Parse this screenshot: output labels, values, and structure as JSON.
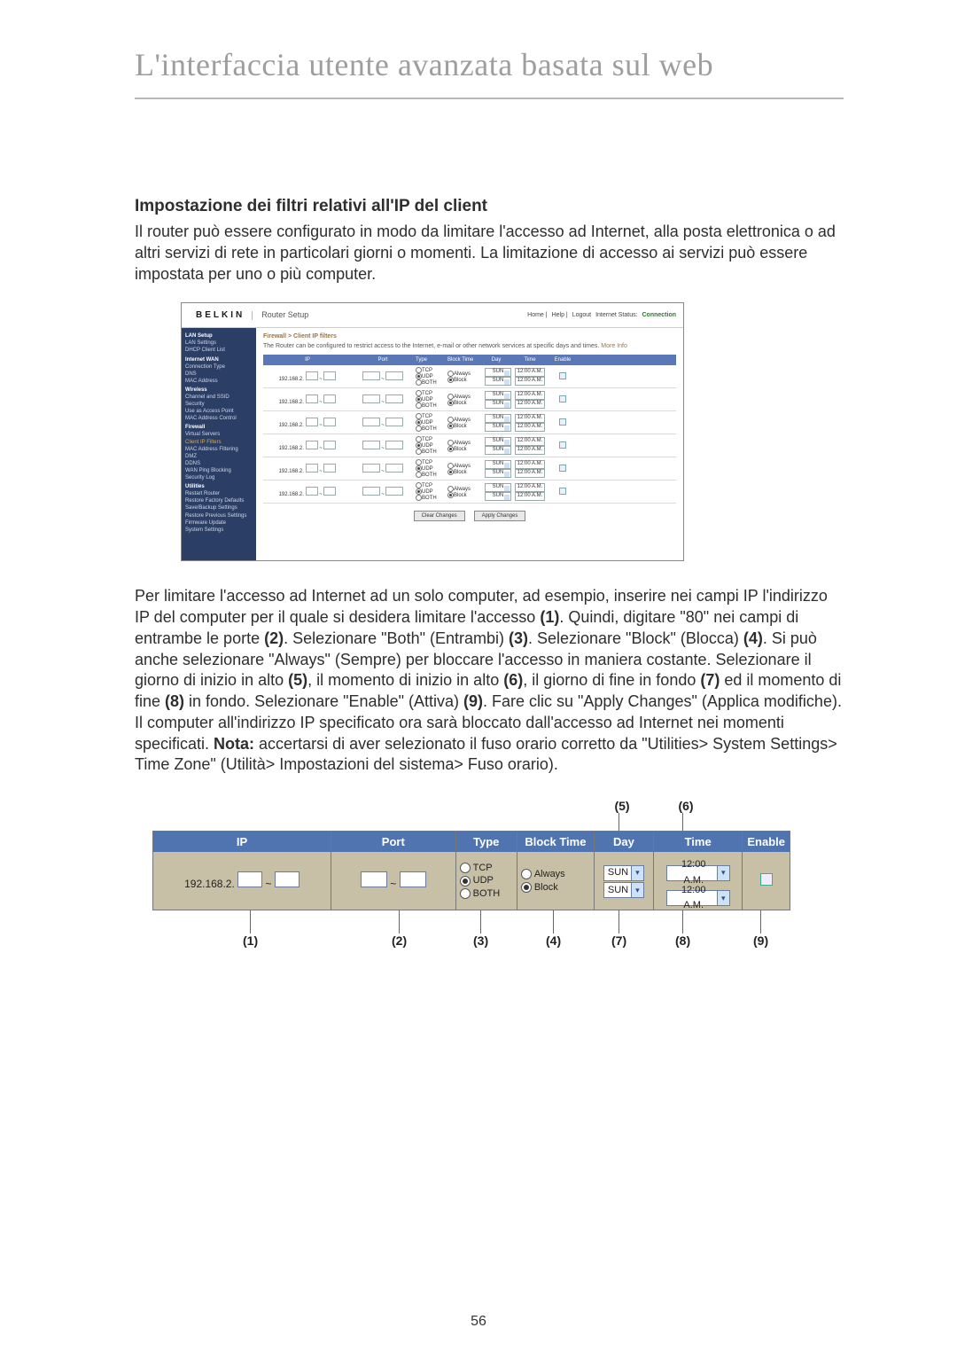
{
  "doc": {
    "title": "L'interfaccia utente avanzata basata sul web",
    "section_heading": "Impostazione dei filtri relativi all'IP del client",
    "intro_para": "Il router può essere configurato in modo da limitare l'accesso ad Internet, alla posta elettronica o ad altri servizi di rete in particolari giorni o momenti. La limitazione di accesso ai servizi può essere impostata per uno o più computer.",
    "explain_para_html": "Per limitare l'accesso ad Internet ad un solo computer, ad esempio, inserire nei campi IP l'indirizzo IP del computer per il quale si desidera limitare l'accesso <b>(1)</b>. Quindi, digitare \"80\" nei campi di entrambe le porte <b>(2)</b>. Selezionare \"Both\" (Entrambi) <b>(3)</b>. Selezionare \"Block\" (Blocca) <b>(4)</b>. Si può anche selezionare \"Always\" (Sempre) per bloccare l'accesso in maniera costante. Selezionare il giorno di inizio in alto <b>(5)</b>, il momento di inizio in alto <b>(6)</b>, il giorno di fine in fondo <b>(7)</b> ed il momento di fine <b>(8)</b> in fondo. Selezionare \"Enable\" (Attiva) <b>(9)</b>. Fare clic su \"Apply Changes\" (Applica modifiche). Il computer all'indirizzo IP specificato ora sarà bloccato dall'accesso ad Internet nei momenti specificati. <b>Nota:</b> accertarsi di aver selezionato il fuso orario corretto da  \"Utilities> System Settings> Time Zone\" (Utilità> Impostazioni del sistema> Fuso orario).",
    "page_number": "56"
  },
  "router": {
    "brand": "BELKIN",
    "subtitle": "Router Setup",
    "top_links": {
      "home": "Home",
      "help": "Help",
      "logout": "Logout",
      "status_label": "Internet Status:",
      "status_value": "Connection"
    },
    "breadcrumb": "Firewall > Client IP filters",
    "description": "The Router can be configured to restrict access to the Internet, e-mail or other network services at specific days and times.",
    "more": "More Info",
    "side": {
      "groups": [
        {
          "head": "LAN Setup",
          "items": [
            "LAN Settings",
            "DHCP Client List"
          ]
        },
        {
          "head": "Internet WAN",
          "items": [
            "Connection Type",
            "DNS",
            "MAC Address"
          ]
        },
        {
          "head": "Wireless",
          "items": [
            "Channel and SSID",
            "Security",
            "Use as Access Point",
            "MAC Address Control"
          ]
        },
        {
          "head": "Firewall",
          "items": [
            "Virtual Servers",
            "Client IP Filters",
            "MAC Address Filtering",
            "DMZ",
            "DDNS",
            "WAN Ping Blocking",
            "Security Log"
          ],
          "active_index": 1
        },
        {
          "head": "Utilities",
          "items": [
            "Restart Router",
            "Restore Factory Defaults",
            "Save/Backup Settings",
            "Restore Previous Settings",
            "Firmware Update",
            "System Settings"
          ]
        }
      ]
    },
    "columns": {
      "ip": "IP",
      "port": "Port",
      "type": "Type",
      "block_time": "Block Time",
      "day": "Day",
      "time": "Time",
      "enable": "Enable"
    },
    "row": {
      "ip_prefix": "192.168.2.",
      "type_tcp": "TCP",
      "type_udp": "UDP",
      "type_both": "BOTH",
      "bt_always": "Always",
      "bt_block": "Block",
      "day_value": "SUN",
      "time_value": "12:00 A.M."
    },
    "buttons": {
      "clear": "Clear Changes",
      "apply": "Apply Changes"
    }
  },
  "callouts": {
    "c1": "(1)",
    "c2": "(2)",
    "c3": "(3)",
    "c4": "(4)",
    "c5": "(5)",
    "c6": "(6)",
    "c7": "(7)",
    "c8": "(8)",
    "c9": "(9)"
  }
}
